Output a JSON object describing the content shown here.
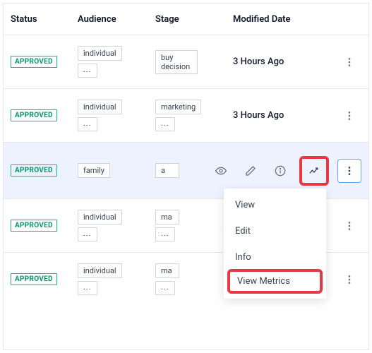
{
  "columns": {
    "status": "Status",
    "audience": "Audience",
    "stage": "Stage",
    "modified": "Modified Date"
  },
  "status_label": "APPROVED",
  "ellipsis": "...",
  "rows": [
    {
      "audience": "individual",
      "audience_more": true,
      "stage": "buy decision",
      "stage_more": false,
      "modified": "3 Hours Ago"
    },
    {
      "audience": "individual",
      "audience_more": true,
      "stage": "marketing",
      "stage_more": true,
      "modified": "3 Hours Ago"
    },
    {
      "audience": "family",
      "audience_more": false,
      "stage": "a",
      "stage_more": false,
      "modified": ""
    },
    {
      "audience": "individual",
      "audience_more": true,
      "stage": "ma",
      "stage_more": true,
      "modified": ""
    },
    {
      "audience": "individual",
      "audience_more": true,
      "stage": "ma",
      "stage_more": true,
      "modified": ""
    }
  ],
  "menu": {
    "view": "View",
    "edit": "Edit",
    "info": "Info",
    "metrics": "View Metrics"
  }
}
